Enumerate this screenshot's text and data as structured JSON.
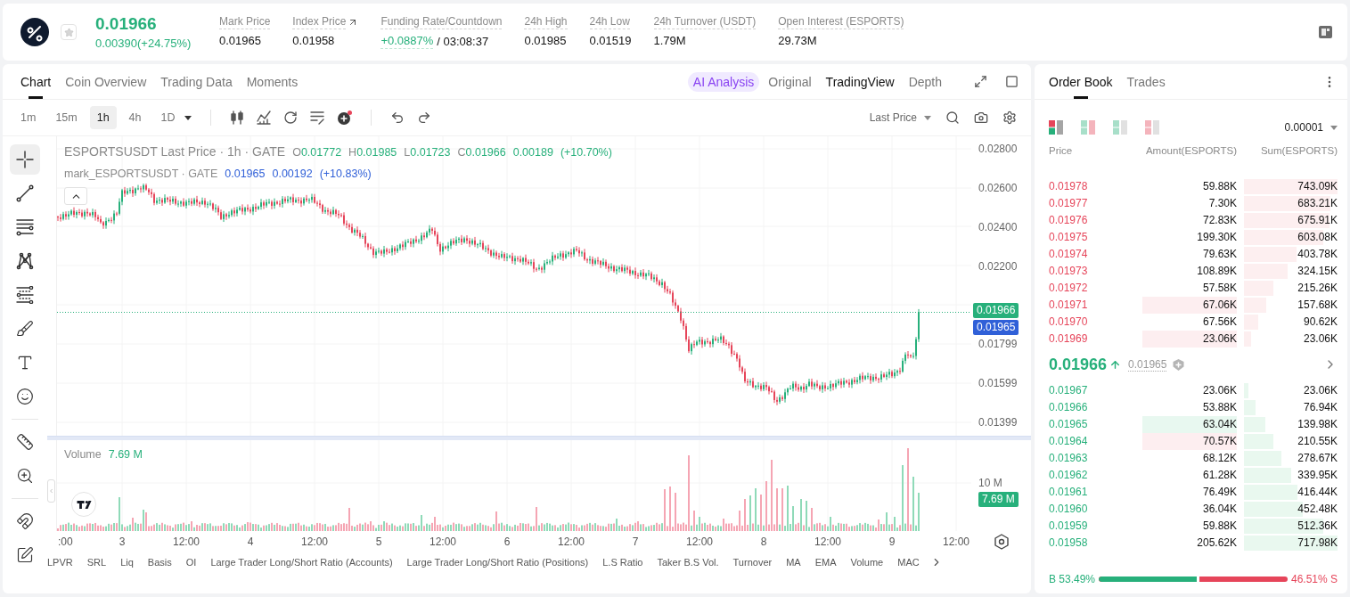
{
  "header": {
    "price": "0.01966",
    "change": "0.00390(+24.75%)",
    "rising": true,
    "stats": [
      {
        "kind": "plain",
        "label": "Mark Price",
        "value": "0.01965"
      },
      {
        "kind": "link",
        "label": "Index Price",
        "value": "0.01958"
      },
      {
        "kind": "funding",
        "label": "Funding Rate/Countdown",
        "rate": "+0.0887%",
        "countdown": "/ 03:08:37"
      },
      {
        "kind": "plain",
        "label": "24h High",
        "value": "0.01985"
      },
      {
        "kind": "plain",
        "label": "24h Low",
        "value": "0.01519"
      },
      {
        "kind": "plain",
        "label": "24h Turnover (USDT)",
        "value": "1.79M"
      },
      {
        "kind": "plain",
        "label": "Open Interest (ESPORTS)",
        "value": "29.73M"
      }
    ]
  },
  "chart": {
    "tabs": [
      {
        "label": "Chart",
        "selected": true
      },
      {
        "label": "Coin Overview",
        "selected": false
      },
      {
        "label": "Trading Data",
        "selected": false
      },
      {
        "label": "Moments",
        "selected": false
      }
    ],
    "ai_button": "AI Analysis",
    "views": [
      {
        "label": "Original",
        "selected": false
      },
      {
        "label": "TradingView",
        "selected": true
      },
      {
        "label": "Depth",
        "selected": false
      }
    ],
    "intervals": [
      {
        "label": "1m",
        "selected": false
      },
      {
        "label": "15m",
        "selected": false
      },
      {
        "label": "1h",
        "selected": true
      },
      {
        "label": "4h",
        "selected": false
      },
      {
        "label": "1D",
        "selected": false
      }
    ],
    "price_source": "Last Price",
    "tools": [
      {
        "selected": true
      },
      {
        "selected": false
      },
      {
        "selected": false
      },
      {
        "selected": false
      },
      {
        "selected": false
      },
      {
        "selected": false
      },
      {
        "selected": false
      },
      {
        "selected": false
      },
      {
        "selected": false
      },
      {
        "selected": false
      },
      {
        "selected": false
      },
      {
        "selected": false
      }
    ],
    "legend": {
      "title": "ESPORTSUSDT Last Price · 1h · GATE",
      "ohlc": [
        {
          "key": "O",
          "value": "0.01772"
        },
        {
          "key": "H",
          "value": "0.01985"
        },
        {
          "key": "L",
          "value": "0.01723"
        },
        {
          "key": "C",
          "value": "0.01966"
        }
      ],
      "change": "0.00189",
      "change_pct": "(+10.70%)"
    },
    "mark_legend": {
      "title": "mark_ESPORTSUSDT · GATE",
      "values": [
        "0.01965",
        "0.00192",
        "(+10.83%)"
      ]
    },
    "price_axis": {
      "upper": [
        "0.02800",
        "0.02600",
        "0.02400",
        "0.02200"
      ],
      "lower": [
        "0.01799",
        "0.01599",
        "0.01399"
      ],
      "last_badge": "0.01966",
      "mark_badge": "0.01965"
    },
    "volume": {
      "label": "Volume",
      "value": "7.69 M",
      "axis_label": "10 M",
      "badge": "7.69 M"
    },
    "time_axis": [
      ":00",
      "3",
      "12:00",
      "4",
      "12:00",
      "5",
      "12:00",
      "6",
      "12:00",
      "7",
      "12:00",
      "8",
      "12:00",
      "9",
      "12:00"
    ],
    "indicators": [
      "LPVR",
      "SRL",
      "Liq",
      "Basis",
      "OI",
      "Large Trader Long/Short Ratio (Accounts)",
      "Large Trader Long/Short Ratio (Positions)",
      "L.S Ratio",
      "Taker B.S Vol.",
      "Turnover",
      "MA",
      "EMA",
      "Volume",
      "MAC"
    ]
  },
  "order_book": {
    "tabs": [
      {
        "label": "Order Book",
        "selected": true
      },
      {
        "label": "Trades",
        "selected": false
      }
    ],
    "view_modes": [
      {
        "kind": "stacked",
        "selected": true
      },
      {
        "kind": "split",
        "selected": false
      },
      {
        "kind": "bids",
        "selected": false
      },
      {
        "kind": "asks",
        "selected": false
      }
    ],
    "precision": "0.00001",
    "columns": [
      "Price",
      "Amount(ESPORTS)",
      "Sum(ESPORTS)"
    ],
    "asks": [
      {
        "kind": "plain",
        "price": "0.01978",
        "amount": "59.88K",
        "sum": "743.09K",
        "level": 1.0
      },
      {
        "kind": "plain",
        "price": "0.01977",
        "amount": "7.30K",
        "sum": "683.21K",
        "level": 0.92
      },
      {
        "kind": "plain",
        "price": "0.01976",
        "amount": "72.83K",
        "sum": "675.91K",
        "level": 0.91
      },
      {
        "kind": "plain",
        "price": "0.01975",
        "amount": "199.30K",
        "sum": "603.08K",
        "level": 0.85
      },
      {
        "kind": "plain",
        "price": "0.01974",
        "amount": "79.63K",
        "sum": "403.78K",
        "level": 0.56
      },
      {
        "kind": "plain",
        "price": "0.01973",
        "amount": "108.89K",
        "sum": "324.15K",
        "level": 0.47
      },
      {
        "kind": "plain",
        "price": "0.01972",
        "amount": "57.58K",
        "sum": "215.26K",
        "level": 0.31
      },
      {
        "kind": "sell_flash",
        "price": "0.01971",
        "amount": "67.06K",
        "sum": "157.68K",
        "level": 0.24
      },
      {
        "kind": "plain",
        "price": "0.01970",
        "amount": "67.56K",
        "sum": "90.62K",
        "level": 0.15
      },
      {
        "kind": "sell_flash",
        "price": "0.01969",
        "amount": "23.06K",
        "sum": "23.06K",
        "level": 0.08
      }
    ],
    "last": {
      "price": "0.01966",
      "rising": true,
      "mark": "0.01965"
    },
    "bids": [
      {
        "kind": "plain",
        "price": "0.01967",
        "amount": "23.06K",
        "sum": "23.06K",
        "level": 0.05
      },
      {
        "kind": "plain",
        "price": "0.01966",
        "amount": "53.88K",
        "sum": "76.94K",
        "level": 0.12
      },
      {
        "kind": "buy_flash",
        "price": "0.01965",
        "amount": "63.04K",
        "sum": "139.98K",
        "level": 0.23
      },
      {
        "kind": "sell_flash",
        "price": "0.01964",
        "amount": "70.57K",
        "sum": "210.55K",
        "level": 0.31
      },
      {
        "kind": "plain",
        "price": "0.01963",
        "amount": "68.12K",
        "sum": "278.67K",
        "level": 0.4
      },
      {
        "kind": "plain",
        "price": "0.01962",
        "amount": "61.28K",
        "sum": "339.95K",
        "level": 0.5
      },
      {
        "kind": "plain",
        "price": "0.01961",
        "amount": "76.49K",
        "sum": "416.44K",
        "level": 0.57
      },
      {
        "kind": "plain",
        "price": "0.01960",
        "amount": "36.04K",
        "sum": "452.48K",
        "level": 0.63
      },
      {
        "kind": "plain",
        "price": "0.01959",
        "amount": "59.88K",
        "sum": "512.36K",
        "level": 0.85
      },
      {
        "kind": "plain",
        "price": "0.01958",
        "amount": "205.62K",
        "sum": "717.98K",
        "level": 1.0
      }
    ],
    "ratio": {
      "buy": "B 53.49%",
      "sell": "46.51% S",
      "level": 0.5349
    }
  }
}
